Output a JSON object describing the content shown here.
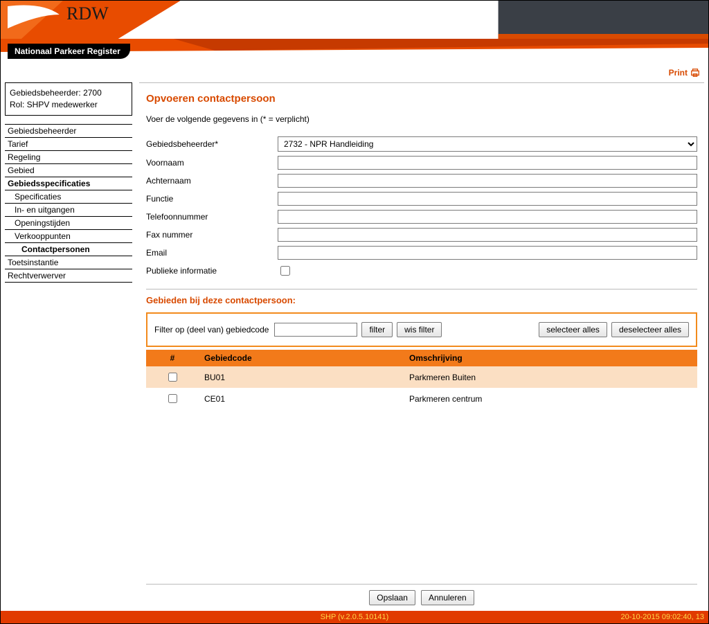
{
  "brand": {
    "name": "RDW",
    "subtitle": "Nationaal Parkeer Register"
  },
  "print_label": "Print",
  "sidebar": {
    "info_line1": "Gebiedsbeheerder: 2700",
    "info_line2": "Rol: SHPV medewerker",
    "items": [
      {
        "label": "Gebiedsbeheerder"
      },
      {
        "label": "Tarief"
      },
      {
        "label": "Regeling"
      },
      {
        "label": "Gebied"
      },
      {
        "label": "Gebiedsspecificaties"
      },
      {
        "label": "Specificaties"
      },
      {
        "label": "In- en uitgangen"
      },
      {
        "label": "Openingstijden"
      },
      {
        "label": "Verkooppunten"
      },
      {
        "label": "Contactpersonen"
      },
      {
        "label": "Toetsinstantie"
      },
      {
        "label": "Rechtverwerver"
      }
    ]
  },
  "page": {
    "title": "Opvoeren contactpersoon",
    "instruction": "Voer de volgende gegevens in (* = verplicht)",
    "fields": {
      "gebiedsbeheerder_label": "Gebiedsbeheerder*",
      "gebiedsbeheerder_value": "2732 - NPR Handleiding",
      "voornaam_label": "Voornaam",
      "achternaam_label": "Achternaam",
      "functie_label": "Functie",
      "telefoon_label": "Telefoonnummer",
      "fax_label": "Fax nummer",
      "email_label": "Email",
      "publiek_label": "Publieke informatie"
    },
    "section_title": "Gebieden bij deze contactpersoon:",
    "filter": {
      "label": "Filter op (deel van) gebiedcode",
      "btn_filter": "filter",
      "btn_clear": "wis filter",
      "btn_select_all": "selecteer alles",
      "btn_deselect_all": "deselecteer alles"
    },
    "table": {
      "col_check": "#",
      "col_code": "Gebiedcode",
      "col_desc": "Omschrijving",
      "rows": [
        {
          "code": "BU01",
          "desc": "Parkmeren Buiten"
        },
        {
          "code": "CE01",
          "desc": "Parkmeren centrum"
        }
      ]
    },
    "actions": {
      "save": "Opslaan",
      "cancel": "Annuleren"
    }
  },
  "footer": {
    "center": "SHP (v.2.0.5.10141)",
    "right": "20-10-2015 09:02:40, 13"
  }
}
